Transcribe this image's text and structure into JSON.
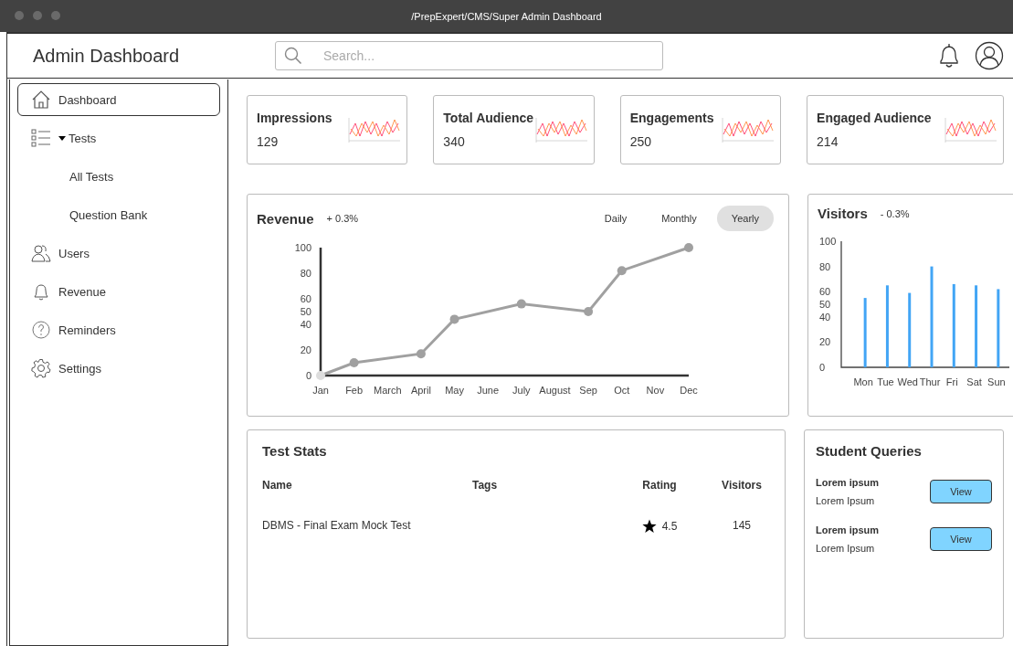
{
  "window": {
    "title": "/PrepExpert/CMS/Super Admin Dashboard"
  },
  "header": {
    "title": "Admin Dashboard",
    "search": {
      "placeholder": "Search..."
    }
  },
  "sidebar": {
    "items": [
      {
        "kind": "home",
        "label": "Dashboard",
        "selected": true
      },
      {
        "kind": "list",
        "label": "Tests",
        "selected": false,
        "expanded": true,
        "children": [
          {
            "label": "All Tests",
            "selected": false
          },
          {
            "label": "Question Bank",
            "selected": false
          }
        ]
      },
      {
        "kind": "users",
        "label": "Users",
        "selected": false
      },
      {
        "kind": "bell",
        "label": "Revenue",
        "selected": false
      },
      {
        "kind": "help",
        "label": "Reminders",
        "selected": false
      },
      {
        "kind": "gear",
        "label": "Settings",
        "selected": false
      }
    ]
  },
  "stats": [
    {
      "label": "Impressions",
      "value": "129"
    },
    {
      "label": "Total Audience",
      "value": "340"
    },
    {
      "label": "Engagements",
      "value": "250"
    },
    {
      "label": "Engaged Audience",
      "value": "214"
    }
  ],
  "revenue": {
    "title": "Revenue",
    "change": "+ 0.3%",
    "tabs": [
      {
        "label": "Daily",
        "selected": false
      },
      {
        "label": "Monthly",
        "selected": false
      },
      {
        "label": "Yearly",
        "selected": true
      }
    ],
    "chart_data": {
      "type": "line",
      "categories": [
        "Jan",
        "Feb",
        "March",
        "April",
        "May",
        "June",
        "July",
        "August",
        "Sep",
        "Oct",
        "Nov",
        "Dec"
      ],
      "series": [
        {
          "color": "#a0a0a0",
          "marker": "circle",
          "values": [
            0,
            10,
            null,
            17,
            44,
            null,
            56,
            null,
            50,
            82,
            null,
            100
          ]
        }
      ],
      "ylim": [
        0,
        100
      ],
      "yticks": [
        0,
        20,
        40,
        50,
        60,
        80,
        100
      ]
    }
  },
  "visitors": {
    "title": "Visitors",
    "change": "- 0.3%",
    "chart_data": {
      "type": "bar",
      "categories": [
        "Mon",
        "Tue",
        "Wed",
        "Thur",
        "Fri",
        "Sat",
        "Sun"
      ],
      "series": [
        {
          "color": "#42a5f5",
          "values": [
            55,
            65,
            59,
            80,
            66,
            65,
            62
          ]
        }
      ],
      "ylim": [
        0,
        100
      ],
      "yticks": [
        0,
        20,
        40,
        50,
        60,
        80,
        100
      ]
    }
  },
  "test_stats": {
    "title": "Test Stats",
    "columns": [
      "Name",
      "Tags",
      "Rating",
      "Visitors"
    ],
    "rows": [
      {
        "name": "DBMS - Final Exam Mock Test",
        "rating": "4.5",
        "visitors": "145"
      }
    ]
  },
  "queries": {
    "title": "Student Queries",
    "items": [
      {
        "title": "Lorem ipsum",
        "text": "Lorem Ipsum",
        "button": "View"
      },
      {
        "title": "Lorem ipsum",
        "text": "Lorem Ipsum",
        "button": "View"
      }
    ]
  }
}
